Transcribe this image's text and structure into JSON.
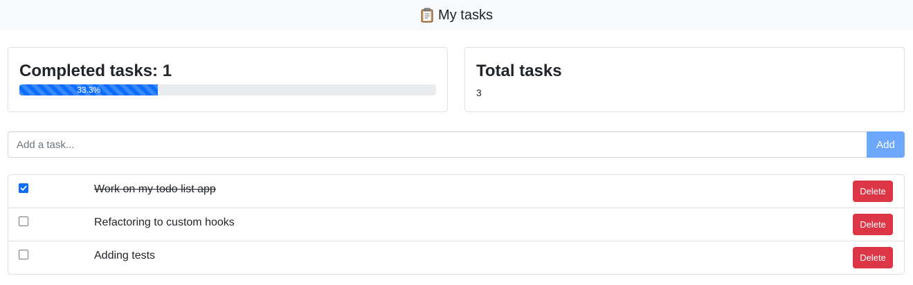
{
  "header": {
    "title": "My tasks",
    "icon": "clipboard-icon"
  },
  "completed_card": {
    "title": "Completed tasks: 1",
    "progress_label": "33.3%",
    "progress_fraction": 0.333,
    "bar_color": "#0d6efd"
  },
  "total_card": {
    "title": "Total tasks",
    "value": "3"
  },
  "add_form": {
    "placeholder": "Add a task...",
    "button_label": "Add",
    "button_color": "#6ea8fe"
  },
  "tasks": [
    {
      "text": "Work on my todo list app",
      "completed": true,
      "delete_label": "Delete"
    },
    {
      "text": "Refactoring to custom hooks",
      "completed": false,
      "delete_label": "Delete"
    },
    {
      "text": "Adding tests",
      "completed": false,
      "delete_label": "Delete"
    }
  ],
  "colors": {
    "delete": "#dc3545",
    "header_bg": "#f8f9fa"
  }
}
